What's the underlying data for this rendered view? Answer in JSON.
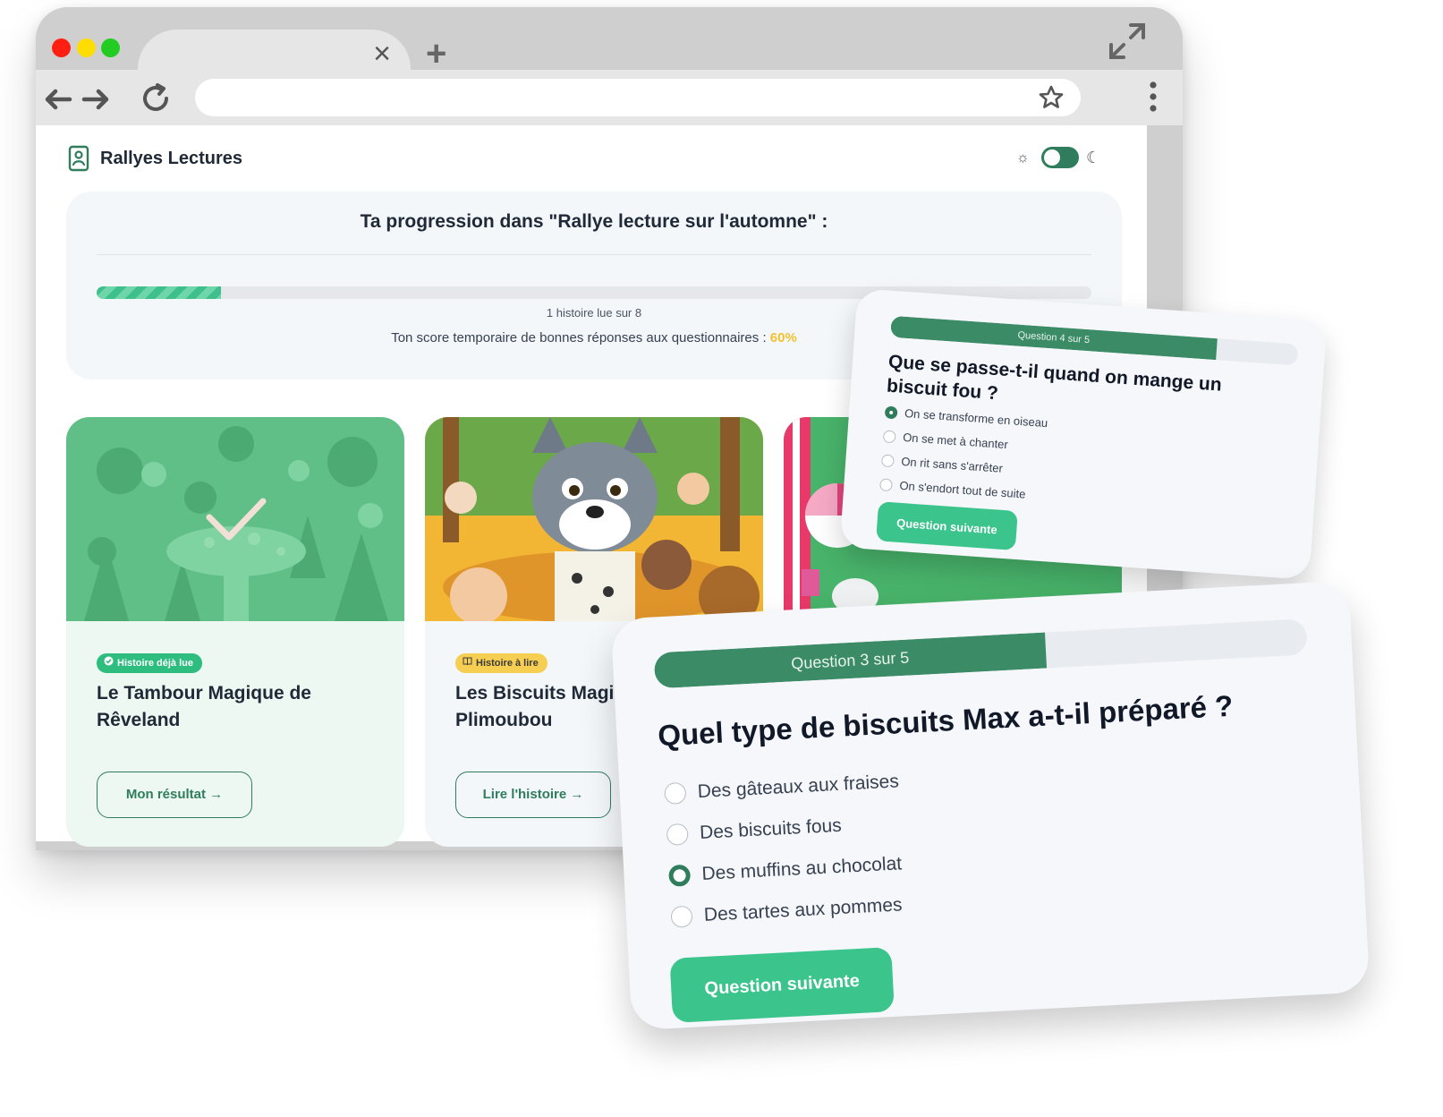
{
  "browser": {
    "tab_close": "×",
    "tab_new": "+"
  },
  "app": {
    "name": "Rallyes Lectures",
    "theme_sun": "☼",
    "theme_moon": "☾"
  },
  "progress": {
    "title": "Ta progression dans \"Rallye lecture sur l'automne\" :",
    "fraction": 0.125,
    "caption": "1 histoire lue sur 8",
    "score_label": "Ton score temporaire de bonnes réponses aux questionnaires :",
    "score_value": "60%"
  },
  "stories": [
    {
      "badge": "Histoire déjà lue",
      "badge_icon": "check-circle-icon",
      "title": "Le Tambour Magique de Rêveland",
      "button": "Mon résultat  →",
      "status": "read"
    },
    {
      "badge": "Histoire à lire",
      "badge_icon": "book-icon",
      "title": "Les Biscuits Magiques de Plimoubou",
      "button": "Lire l'histoire  →",
      "status": "to-read"
    }
  ],
  "quiz_small": {
    "counter": "Question 4 sur 5",
    "fraction": 0.8,
    "question": "Que se passe-t-il quand on mange un biscuit fou ?",
    "options": [
      "On se transforme en oiseau",
      "On se met à chanter",
      "On rit sans s'arrêter",
      "On s'endort tout de suite"
    ],
    "selected": 0,
    "next": "Question suivante"
  },
  "quiz_big": {
    "counter": "Question 3 sur 5",
    "fraction": 0.6,
    "question": "Quel type de biscuits Max a-t-il préparé ?",
    "options": [
      "Des gâteaux aux fraises",
      "Des biscuits fous",
      "Des muffins au chocolat",
      "Des tartes aux pommes"
    ],
    "selected": 2,
    "next": "Question suivante"
  },
  "colors": {
    "brand": "#2f7d5c",
    "accent": "#3cc48d",
    "score": "#f2c12e",
    "badge_read": "#2dbd7e",
    "badge_todo": "#f6cf52"
  }
}
